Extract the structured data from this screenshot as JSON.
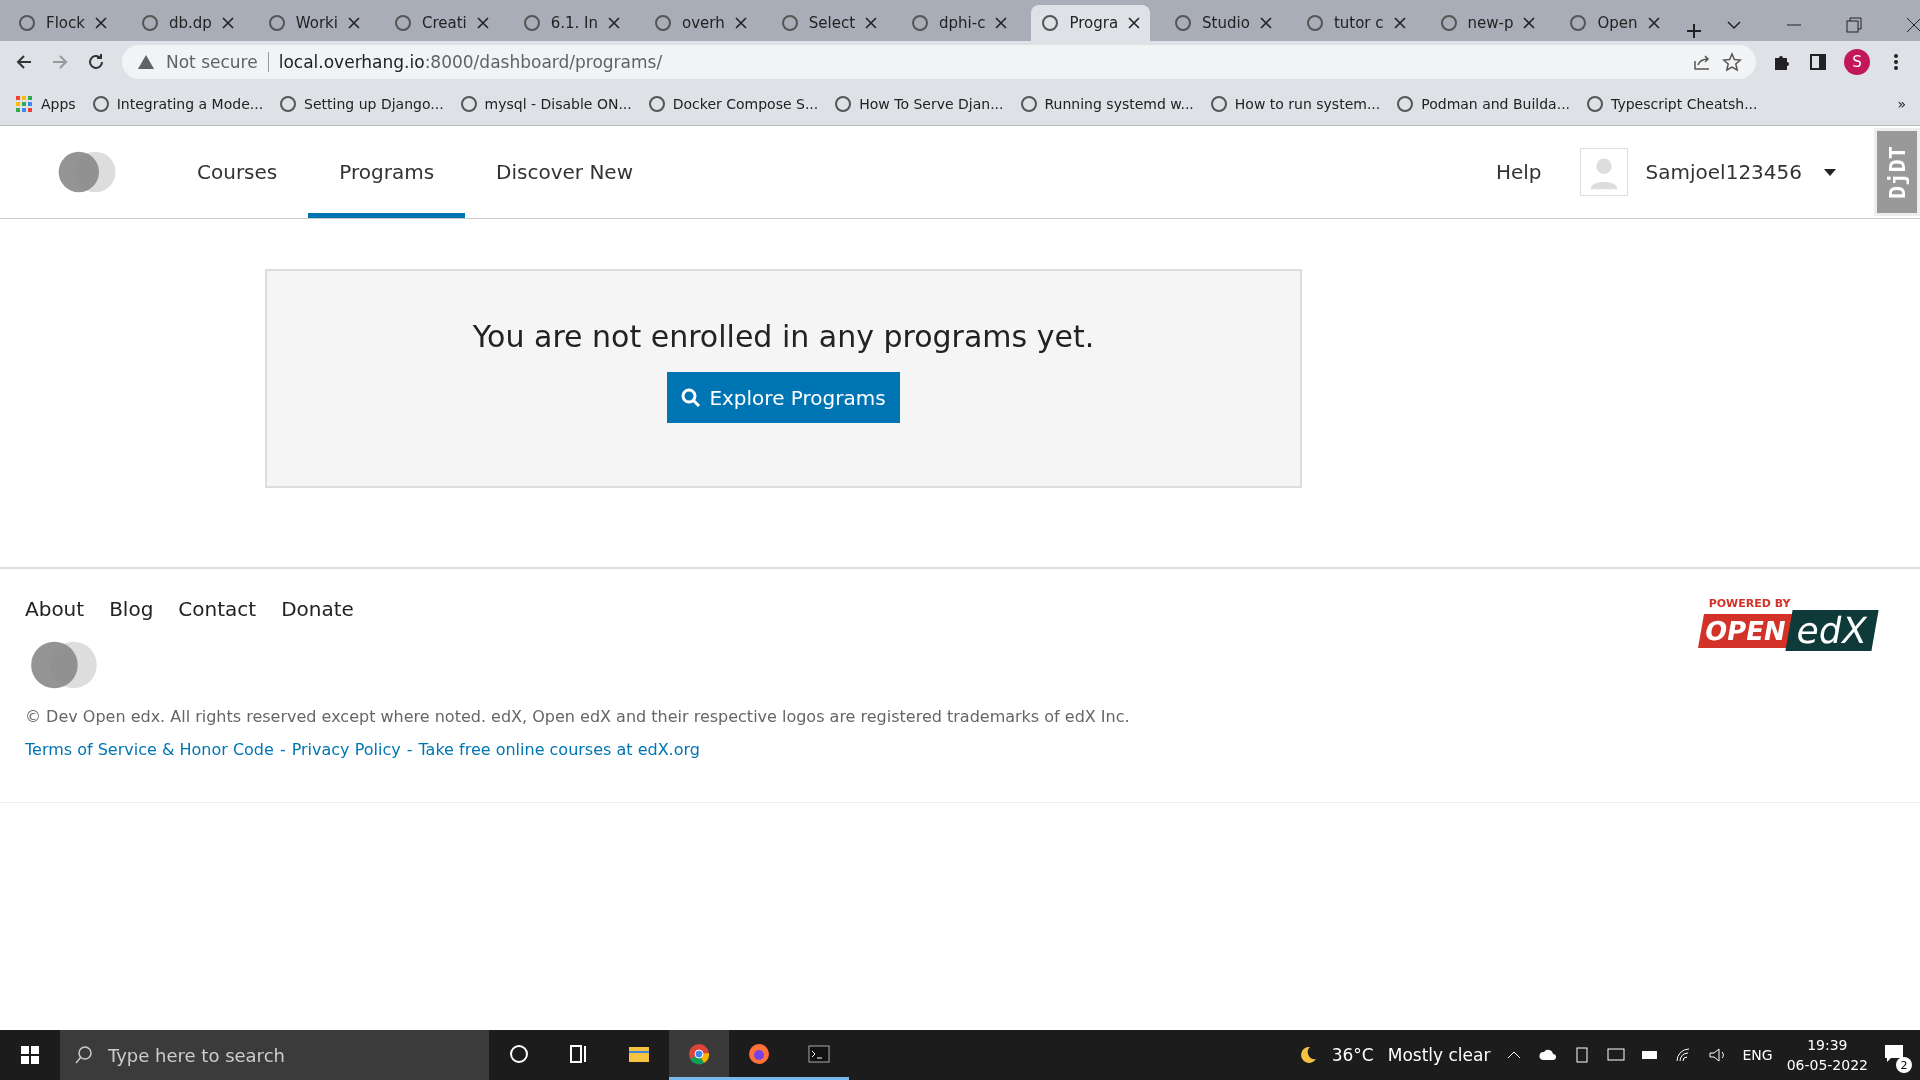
{
  "browser": {
    "tabs": [
      {
        "title": "Flock",
        "selected": false
      },
      {
        "title": "db.dp",
        "selected": false
      },
      {
        "title": "Worki",
        "selected": false
      },
      {
        "title": "Creati",
        "selected": false
      },
      {
        "title": "6.1. In",
        "selected": false
      },
      {
        "title": "overh",
        "selected": false
      },
      {
        "title": "Select",
        "selected": false
      },
      {
        "title": "dphi-c",
        "selected": false
      },
      {
        "title": "Progra",
        "selected": true
      },
      {
        "title": "Studio",
        "selected": false
      },
      {
        "title": "tutor c",
        "selected": false
      },
      {
        "title": "new-p",
        "selected": false
      },
      {
        "title": "Open",
        "selected": false
      }
    ],
    "security": "Not secure",
    "url_host": "local.overhang.io",
    "url_rest": ":8000/dashboard/programs/",
    "profile_initial": "S",
    "bookmarks": [
      "Apps",
      "Integrating a Mode...",
      "Setting up Django...",
      "mysql - Disable ON...",
      "Docker Compose S...",
      "How To Serve Djan...",
      "Running systemd w...",
      "How to run system...",
      "Podman and Builda...",
      "Typescript Cheatsh..."
    ],
    "overflow": "»"
  },
  "header": {
    "nav": [
      {
        "label": "Courses",
        "selected": false
      },
      {
        "label": "Programs",
        "selected": true
      },
      {
        "label": "Discover New",
        "selected": false
      }
    ],
    "help": "Help",
    "username": "Samjoel123456",
    "debug_toolbar": "DjDT"
  },
  "empty_state": {
    "message": "You are not enrolled in any programs yet.",
    "button": "Explore Programs"
  },
  "footer": {
    "links": [
      "About",
      "Blog",
      "Contact",
      "Donate"
    ],
    "copyright": "© Dev Open edx. All rights reserved except where noted. edX, Open edX and their respective logos are registered trademarks of edX Inc.",
    "separator": "-",
    "legal_links": [
      "Terms of Service & Honor Code",
      "Privacy Policy",
      "Take free online courses at edX.org"
    ],
    "powered_by": "POWERED BY",
    "logo_open": "OPEN",
    "logo_edx": "edX"
  },
  "taskbar": {
    "search_placeholder": "Type here to search",
    "apps": [
      {
        "kind": "cortana",
        "running": false
      },
      {
        "kind": "taskview",
        "running": false
      },
      {
        "kind": "files",
        "running": false
      },
      {
        "kind": "chrome",
        "running": true
      },
      {
        "kind": "firefox",
        "running": true
      },
      {
        "kind": "terminal",
        "running": true
      }
    ],
    "temperature": "36°C",
    "weather": "Mostly clear",
    "language": "ENG",
    "time": "19:39",
    "date": "06-05-2022",
    "notifications": "2"
  }
}
